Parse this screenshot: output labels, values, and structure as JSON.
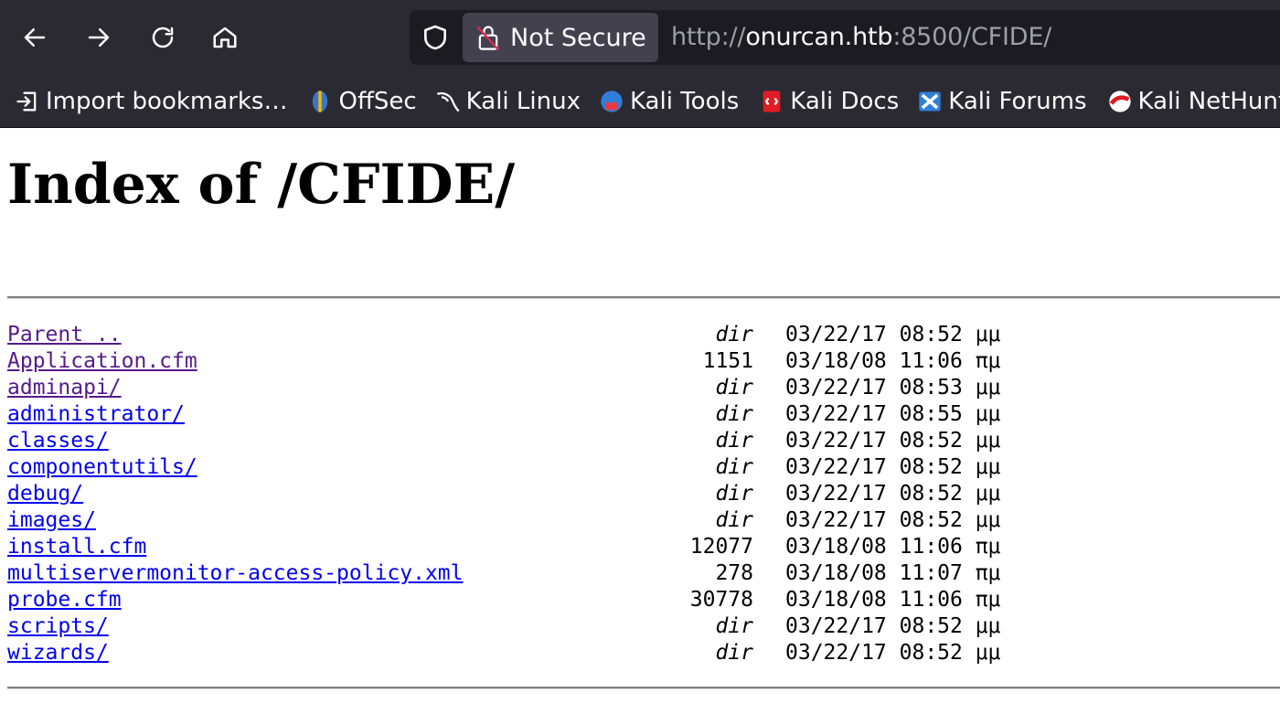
{
  "browser": {
    "not_secure_label": "Not Secure",
    "url_scheme": "http://",
    "url_host": "onurcan.htb",
    "url_rest": ":8500/CFIDE/"
  },
  "bookmarks": [
    {
      "label": "Import bookmarks…",
      "icon": "import-icon"
    },
    {
      "label": "OffSec",
      "icon": "offsec-icon"
    },
    {
      "label": "Kali Linux",
      "icon": "kali-dragon-icon"
    },
    {
      "label": "Kali Tools",
      "icon": "kali-tools-icon"
    },
    {
      "label": "Kali Docs",
      "icon": "kali-docs-icon"
    },
    {
      "label": "Kali Forums",
      "icon": "kali-forums-icon"
    },
    {
      "label": "Kali NetHunter",
      "icon": "kali-nethunter-icon"
    }
  ],
  "page": {
    "title": "Index of /CFIDE/"
  },
  "entries": [
    {
      "name": "Parent ..",
      "size": "dir",
      "date": "03/22/17 08:52 μμ",
      "visited": true
    },
    {
      "name": "Application.cfm",
      "size": "1151",
      "date": "03/18/08 11:06 πμ",
      "visited": true
    },
    {
      "name": "adminapi/",
      "size": "dir",
      "date": "03/22/17 08:53 μμ",
      "visited": true
    },
    {
      "name": "administrator/",
      "size": "dir",
      "date": "03/22/17 08:55 μμ",
      "visited": false
    },
    {
      "name": "classes/",
      "size": "dir",
      "date": "03/22/17 08:52 μμ",
      "visited": false
    },
    {
      "name": "componentutils/",
      "size": "dir",
      "date": "03/22/17 08:52 μμ",
      "visited": false
    },
    {
      "name": "debug/",
      "size": "dir",
      "date": "03/22/17 08:52 μμ",
      "visited": false
    },
    {
      "name": "images/",
      "size": "dir",
      "date": "03/22/17 08:52 μμ",
      "visited": false
    },
    {
      "name": "install.cfm",
      "size": "12077",
      "date": "03/18/08 11:06 πμ",
      "visited": false
    },
    {
      "name": "multiservermonitor-access-policy.xml",
      "size": "278",
      "date": "03/18/08 11:07 πμ",
      "visited": false
    },
    {
      "name": "probe.cfm",
      "size": "30778",
      "date": "03/18/08 11:06 πμ",
      "visited": false
    },
    {
      "name": "scripts/",
      "size": "dir",
      "date": "03/22/17 08:52 μμ",
      "visited": false
    },
    {
      "name": "wizards/",
      "size": "dir",
      "date": "03/22/17 08:52 μμ",
      "visited": false
    }
  ]
}
